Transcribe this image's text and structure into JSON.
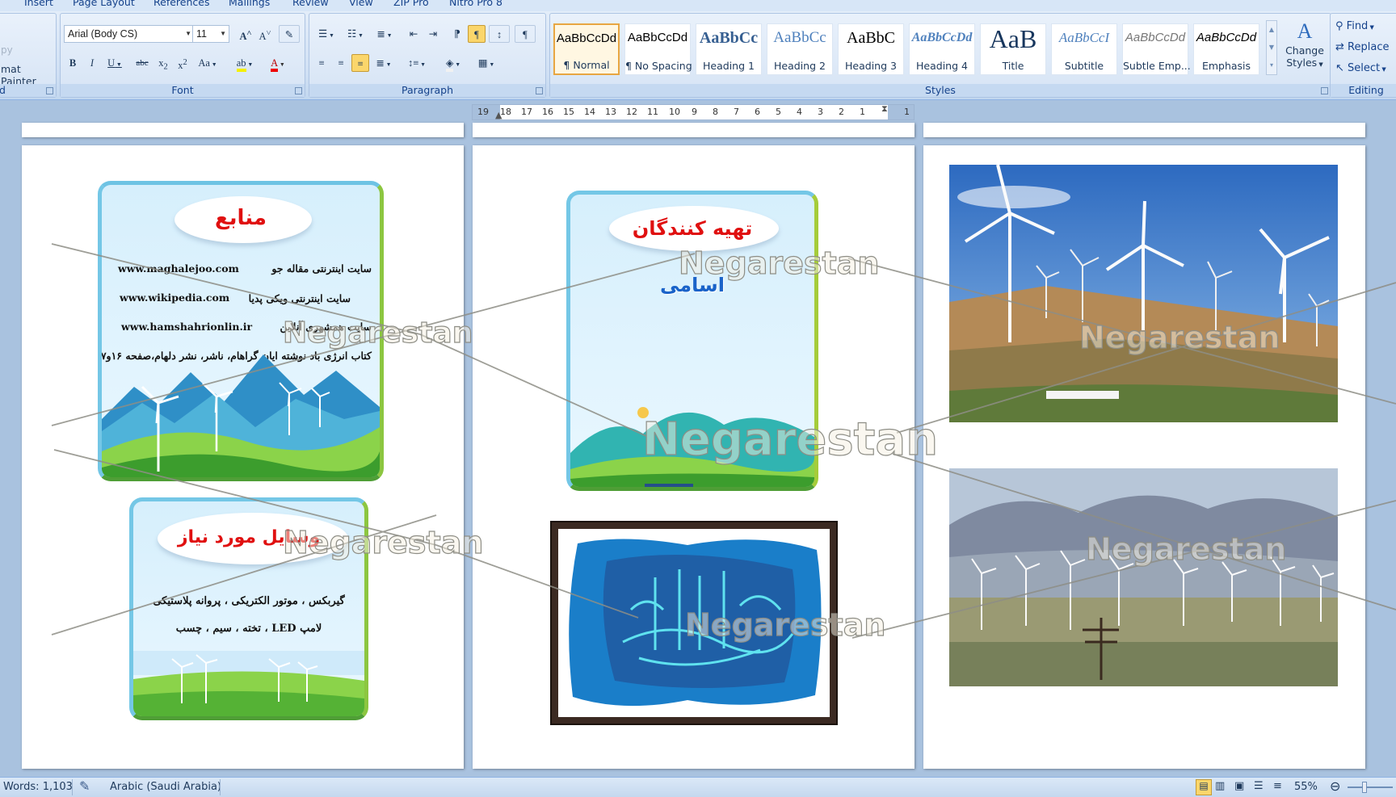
{
  "tabs": [
    "Insert",
    "Page Layout",
    "References",
    "Mailings",
    "Review",
    "View",
    "ZIP Pro",
    "Nitro Pro 8"
  ],
  "clipboard": {
    "copy": "py",
    "format_painter": "mat Painter"
  },
  "font": {
    "name": "Arial (Body CS)",
    "size": "11",
    "label": "Font"
  },
  "paragraph": {
    "label": "Paragraph"
  },
  "styles": {
    "label": "Styles",
    "items": [
      {
        "preview": "AaBbCcDd",
        "name": "¶ Normal"
      },
      {
        "preview": "AaBbCcDd",
        "name": "¶ No Spacing"
      },
      {
        "preview": "AaBbCc",
        "name": "Heading 1"
      },
      {
        "preview": "AaBbCc",
        "name": "Heading 2"
      },
      {
        "preview": "AaBbC",
        "name": "Heading 3"
      },
      {
        "preview": "AaBbCcDd",
        "name": "Heading 4"
      },
      {
        "preview": "AaB",
        "name": "Title"
      },
      {
        "preview": "AaBbCcI",
        "name": "Subtitle"
      },
      {
        "preview": "AaBbCcDd",
        "name": "Subtle Emp..."
      },
      {
        "preview": "AaBbCcDd",
        "name": "Emphasis"
      }
    ],
    "change": "Change",
    "change2": "Styles"
  },
  "editing": {
    "label": "Editing",
    "find": "Find",
    "replace": "Replace",
    "select": "Select"
  },
  "ruler": [
    "19",
    "18",
    "17",
    "16",
    "15",
    "14",
    "13",
    "12",
    "11",
    "10",
    "9",
    "8",
    "7",
    "6",
    "5",
    "4",
    "3",
    "2",
    "1",
    "1"
  ],
  "page1": {
    "card1": {
      "title": "منابع",
      "rows": [
        {
          "right": "سایت اینترنتی مقاله جو",
          "left": "www.maghalejoo.com"
        },
        {
          "right": "سایت اینترنتی ویکی پدیا",
          "left": "www.wikipedia.com"
        },
        {
          "right": "سایت همشهری آنلاین",
          "left": "www.hamshahrionlin.ir"
        }
      ],
      "book": "کتاب انرژی باد نوشته ایان گراهام، ناشر، نشر دلهام،صفحه ۱۶و۱۷"
    },
    "card2": {
      "title": "وسایل مورد نیاز",
      "line1": "گیربکس ، موتور الکتریکی ، پروانه پلاستیکی",
      "line2": "لامپ LED ، تخته ، سیم ، چسب"
    }
  },
  "page2": {
    "card": {
      "title": "تهیه کنندگان",
      "subtitle": "اسامی"
    }
  },
  "watermark": "Negarestan",
  "status": {
    "words": "Words: 1,103",
    "language": "Arabic (Saudi Arabia)",
    "zoom": "55%"
  },
  "colors": {
    "ribbon": "#d0e0f4",
    "group_label": "#15428b",
    "card_title": "#e01010",
    "subtitle": "#1a63c9",
    "selected_style": "#e8a641"
  }
}
